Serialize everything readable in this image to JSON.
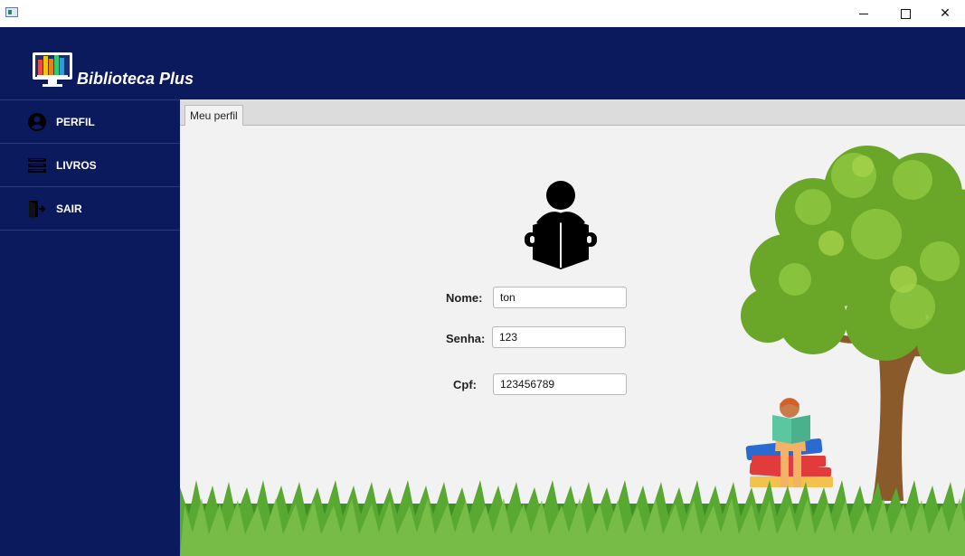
{
  "window": {
    "title": "",
    "icon": "java-app-icon",
    "controls": [
      "minimize-icon",
      "maximize-icon",
      "close-icon"
    ],
    "close_glyph": "✕"
  },
  "header": {
    "brand": "Biblioteca Plus",
    "logo_icon": "library-books-monitor-icon",
    "background": "#0a1a5c"
  },
  "sidebar": {
    "items": [
      {
        "label": "PERFIL",
        "icon": "user-circle-icon"
      },
      {
        "label": "LIVROS",
        "icon": "books-stack-icon"
      },
      {
        "label": "SAIR",
        "icon": "exit-door-icon"
      }
    ]
  },
  "tabs": [
    {
      "label": "Meu perfil",
      "selected": true
    }
  ],
  "profile": {
    "icon": "reader-person-icon",
    "fields": {
      "nome": {
        "label": "Nome:",
        "value": "ton"
      },
      "senha": {
        "label": "Senha:",
        "value": "123"
      },
      "cpf": {
        "label": "Cpf:",
        "value": "123456789"
      }
    }
  },
  "illustration": {
    "elements": [
      "tree",
      "child-reading-on-books",
      "grass"
    ]
  },
  "colors": {
    "nav": "#0a1a5c",
    "content_bg": "#f2f2f2",
    "grass": "#4e9a2a",
    "tree_leaves": "#7cb82f"
  }
}
